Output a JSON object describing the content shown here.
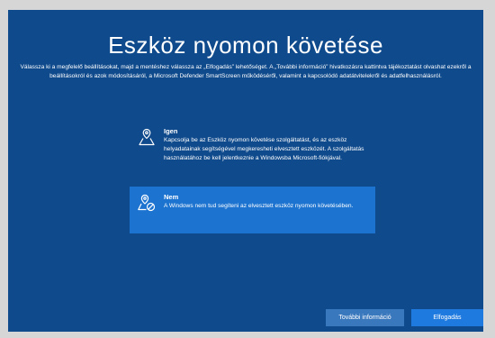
{
  "setup": {
    "title": "Eszköz nyomon követése",
    "description": "Válassza ki a megfelelő beállításokat, majd a mentéshez válassza az „Elfogadás” lehetőséget. A „További információ” hivatkozásra kattintva tájékoztatást olvashat ezekről a beállításokról és azok módosításáról, a Microsoft Defender SmartScreen működéséről, valamint a kapcsolódó adatátvitelekről és adatfelhasználásról.",
    "options": [
      {
        "label": "Igen",
        "description": "Kapcsolja be az Eszköz nyomon követése szolgáltatást, és az eszköz helyadatainak segítségével megkeresheti elvesztett eszközét. A szolgáltatás használatához be kell jelentkeznie a Windowsba Microsoft-fiókjával.",
        "icon": "location-person-icon",
        "selected": false
      },
      {
        "label": "Nem",
        "description": "A Windows nem tud segíteni az elvesztett eszköz nyomon követésében.",
        "icon": "location-off-icon",
        "selected": true
      }
    ],
    "buttons": {
      "more_info": "További információ",
      "accept": "Elfogadás"
    }
  },
  "colors": {
    "background": "#0f4a8c",
    "selected_option": "#1c73d0",
    "accept_button": "#1f7adf"
  }
}
